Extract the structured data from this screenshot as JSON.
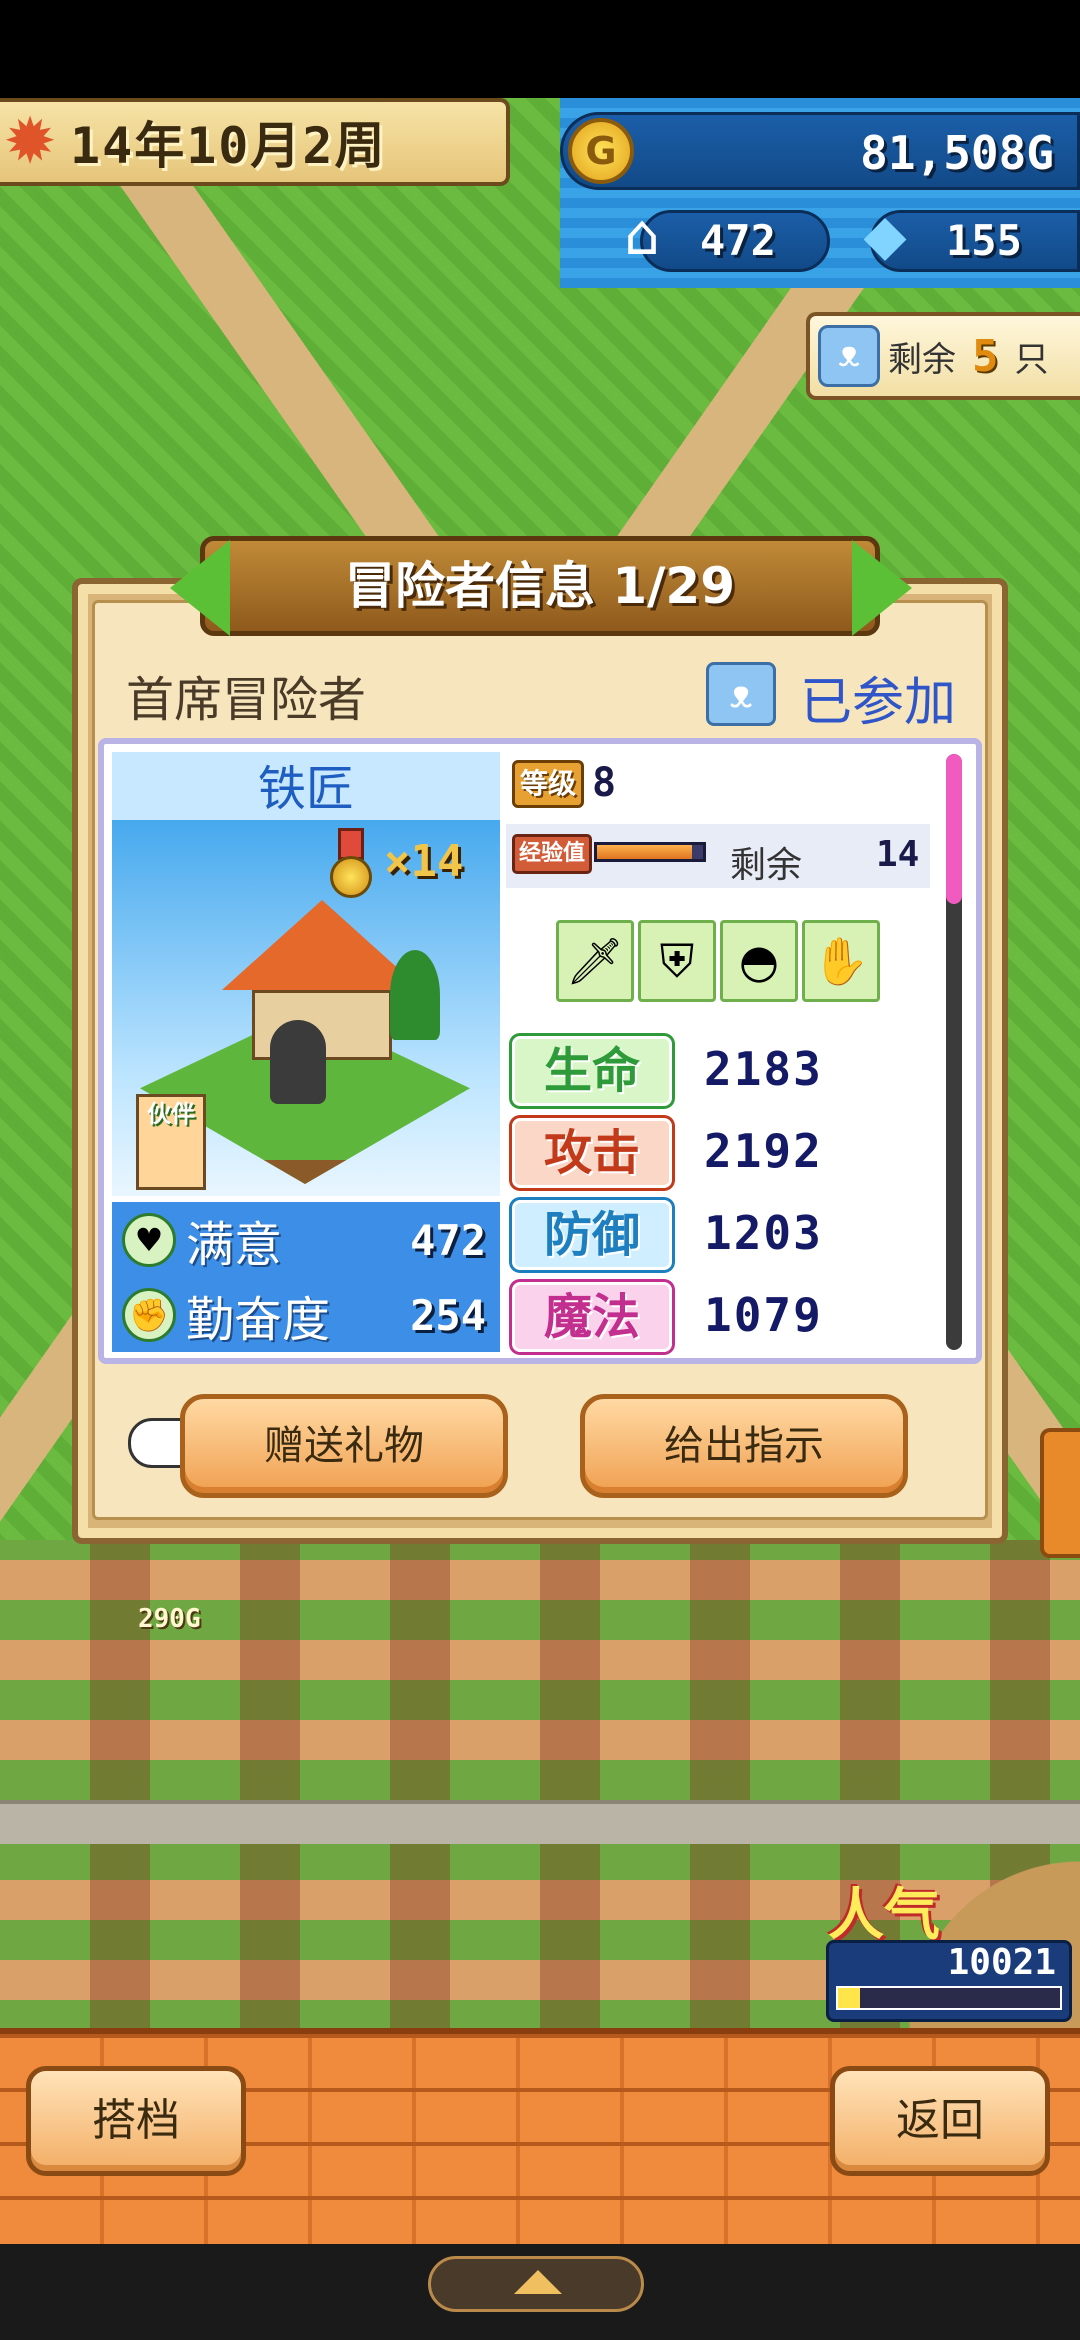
{
  "hud": {
    "date": "14年10月2周",
    "gold": "81,508G",
    "population": "472",
    "gems": "155",
    "remaining_label": "剩余",
    "remaining_count": "5",
    "remaining_unit": "只"
  },
  "dialog": {
    "title": "冒险者信息 1/29",
    "rank_label": "首席冒险者",
    "joined_status": "已参加",
    "job": "铁匠",
    "medal_count": "×14",
    "partner_tag": "伙伴",
    "level_label": "等级",
    "level": "8",
    "exp_label": "经验值",
    "exp_fill_fraction": 0.9,
    "exp_remaining_label": "剩余",
    "exp_remaining": "14",
    "equipment": [
      "sword-icon",
      "armor-icon",
      "helmet-icon",
      "gauntlet-icon"
    ],
    "left_stats": [
      {
        "label": "满意",
        "value": "472",
        "icon": "heart-icon"
      },
      {
        "label": "勤奋度",
        "value": "254",
        "icon": "fist-icon"
      }
    ],
    "stats": [
      {
        "label": "生命",
        "value": "2183",
        "color": "#2f9a3a",
        "bg": "#d9f6c8"
      },
      {
        "label": "攻击",
        "value": "2192",
        "color": "#c23a1a",
        "bg": "#fbd7c8"
      },
      {
        "label": "防御",
        "value": "1203",
        "color": "#1d7fbf",
        "bg": "#cfeeff"
      },
      {
        "label": "魔法",
        "value": "1079",
        "color": "#c22f8e",
        "bg": "#fbd2ec"
      }
    ],
    "gift_button": "赠送礼物",
    "instruction_button": "给出指示"
  },
  "scene": {
    "coin_float": "290G",
    "popularity_label": "人气",
    "popularity_value": "10021",
    "popularity_fill_fraction": 0.1
  },
  "bottom": {
    "partner_button": "搭档",
    "back_button": "返回"
  }
}
